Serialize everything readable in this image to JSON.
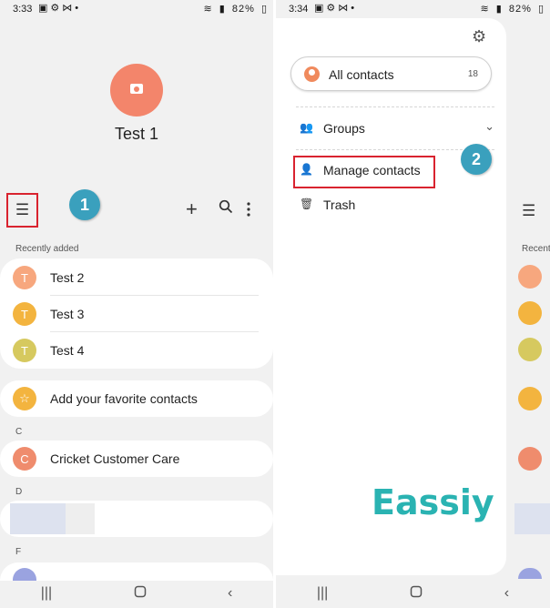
{
  "left": {
    "status": {
      "time": "3:33",
      "battery": "82%"
    },
    "profile": {
      "name": "Test 1"
    },
    "toolbar": {
      "menu_icon": "☰",
      "add_icon": "+",
      "search_icon": "search",
      "more_icon": "more-vert"
    },
    "step_badge": "1",
    "recently_added_label": "Recently added",
    "recent": [
      {
        "letter": "T",
        "name": "Test 2",
        "color": "#f7a77e"
      },
      {
        "letter": "T",
        "name": "Test 3",
        "color": "#f3b43f"
      },
      {
        "letter": "T",
        "name": "Test 4",
        "color": "#d6c95f"
      }
    ],
    "favorites": {
      "label": "Add your favorite contacts",
      "icon": "☆",
      "color": "#f3b43f"
    },
    "section_c": "C",
    "contact_c": {
      "letter": "C",
      "name": "Cricket Customer Care",
      "color": "#ef8c6d"
    },
    "section_d": "D",
    "section_f": "F"
  },
  "right": {
    "status": {
      "time": "3:34",
      "battery": "82%"
    },
    "all_contacts": {
      "label": "All contacts",
      "count": "18"
    },
    "groups_label": "Groups",
    "manage_label": "Manage contacts",
    "trash_label": "Trash",
    "step_badge": "2",
    "watermark": "Eassiy"
  },
  "colors": {
    "accent": "#d9232f",
    "badge": "#3aa0bd",
    "watermark": "#2ab3b2"
  }
}
